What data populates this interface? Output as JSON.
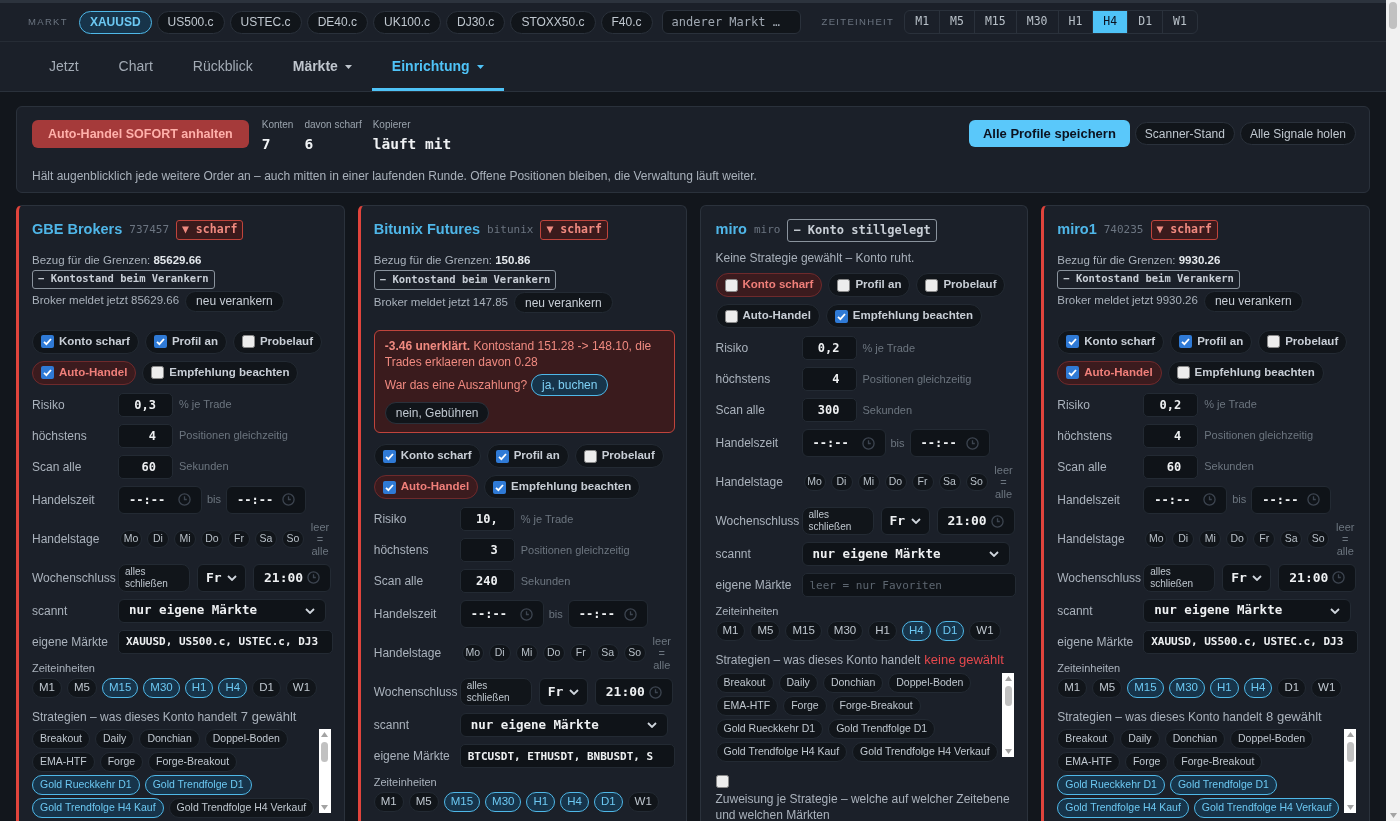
{
  "market_bar": {
    "label": "MARKT",
    "markets": [
      {
        "label": "XAUUSD",
        "selected": true
      },
      {
        "label": "US500.c",
        "selected": false
      },
      {
        "label": "USTEC.c",
        "selected": false
      },
      {
        "label": "DE40.c",
        "selected": false
      },
      {
        "label": "UK100.c",
        "selected": false
      },
      {
        "label": "DJ30.c",
        "selected": false
      },
      {
        "label": "STOXX50.c",
        "selected": false
      },
      {
        "label": "F40.c",
        "selected": false
      }
    ],
    "search": {
      "placeholder": "anderer Markt …"
    },
    "timeframe_label": "ZEITEINHEIT",
    "timeframes": [
      {
        "label": "M1",
        "selected": false
      },
      {
        "label": "M5",
        "selected": false
      },
      {
        "label": "M15",
        "selected": false
      },
      {
        "label": "M30",
        "selected": false
      },
      {
        "label": "H1",
        "selected": false
      },
      {
        "label": "H4",
        "selected": true
      },
      {
        "label": "D1",
        "selected": false
      },
      {
        "label": "W1",
        "selected": false
      }
    ]
  },
  "nav": {
    "tabs": [
      {
        "label": "Jetzt",
        "selected": false,
        "dropdown": false
      },
      {
        "label": "Chart",
        "selected": false,
        "dropdown": false
      },
      {
        "label": "Rückblick",
        "selected": false,
        "dropdown": false
      },
      {
        "label": "Märkte",
        "selected": false,
        "dropdown": true
      },
      {
        "label": "Einrichtung",
        "selected": true,
        "dropdown": true
      }
    ]
  },
  "control_panel": {
    "stop_button": "Auto-Handel SOFORT anhalten",
    "stats": [
      {
        "label": "Konten",
        "value": "7"
      },
      {
        "label": "davon scharf",
        "value": "6"
      },
      {
        "label": "Kopierer",
        "value": "läuft mit"
      }
    ],
    "actions": [
      {
        "label": "Alle Profile speichern",
        "kind": "primary"
      },
      {
        "label": "Scanner-Stand",
        "kind": "secondary"
      },
      {
        "label": "Alle Signale holen",
        "kind": "secondary"
      }
    ],
    "note": "Hält augenblicklich jede weitere Order an – auch mitten in einer laufenden Runde. Offene Positionen bleiben, die Verwaltung läuft weiter."
  },
  "accounts": [
    {
      "name": "GBE Brokers",
      "id": "737457",
      "armed": true,
      "badge": "▼ scharf",
      "reference": "Bezug für die Grenzen: **85629.66**",
      "anchor_tag": "− Kontostand beim Verankern",
      "broker_balance": "Broker meldet jetzt 85629.66",
      "reanchor_button": "neu verankern",
      "toggles": [
        {
          "label": "Konto scharf",
          "checked": true,
          "warn": false
        },
        {
          "label": "Profil an",
          "checked": true,
          "warn": false
        },
        {
          "label": "Probelauf",
          "checked": false,
          "warn": false
        },
        {
          "label": "Auto-Handel",
          "checked": true,
          "warn": true
        },
        {
          "label": "Empfehlung beachten",
          "checked": false,
          "warn": false
        }
      ],
      "fields": [
        {
          "label": "Risiko",
          "value": "0,3",
          "unit": "% je Trade"
        },
        {
          "label": "höchstens",
          "value": "4",
          "unit": "Positionen gleichzeitig"
        },
        {
          "label": "Scan alle",
          "value": "60",
          "unit": "Sekunden"
        }
      ],
      "trading_hours": {
        "label": "Handelszeit",
        "from": "--:--",
        "separator": "bis",
        "to": "--:--"
      },
      "trading_days": {
        "label": "Handelstage",
        "days": [
          {
            "label": "Mo",
            "selected": false
          },
          {
            "label": "Di",
            "selected": false
          },
          {
            "label": "Mi",
            "selected": false
          },
          {
            "label": "Do",
            "selected": false
          },
          {
            "label": "Fr",
            "selected": false
          },
          {
            "label": "Sa",
            "selected": false
          },
          {
            "label": "So",
            "selected": false
          }
        ],
        "hint": "leer = alle"
      },
      "weekend_close": {
        "label": "Wochenschluss",
        "action_button": "alles schließen",
        "day": "Fr",
        "time": "21:00"
      },
      "scan_mode": {
        "label": "scannt",
        "value": "nur eigene Märkte"
      },
      "own_markets": {
        "label": "eigene Märkte",
        "value": "XAUUSD, US500.c, USTEC.c, DJ3"
      },
      "timeframes": {
        "label": "Zeiteinheiten",
        "items": [
          {
            "label": "M1",
            "selected": false
          },
          {
            "label": "M5",
            "selected": false
          },
          {
            "label": "M15",
            "selected": true
          },
          {
            "label": "M30",
            "selected": true
          },
          {
            "label": "H1",
            "selected": true
          },
          {
            "label": "H4",
            "selected": true
          },
          {
            "label": "D1",
            "selected": false
          },
          {
            "label": "W1",
            "selected": false
          }
        ]
      },
      "strategies": {
        "label": "Strategien – was dieses Konto handelt",
        "count": "7 gewählt",
        "warn": false,
        "items": [
          {
            "label": "Breakout",
            "selected": false
          },
          {
            "label": "Daily",
            "selected": false
          },
          {
            "label": "Donchian",
            "selected": false
          },
          {
            "label": "Doppel-Boden",
            "selected": false
          },
          {
            "label": "EMA-HTF",
            "selected": false
          },
          {
            "label": "Forge",
            "selected": false
          },
          {
            "label": "Forge-Breakout",
            "selected": false
          },
          {
            "label": "Gold Rueckkehr D1",
            "selected": true
          },
          {
            "label": "Gold Trendfolge D1",
            "selected": true
          },
          {
            "label": "Gold Trendfolge H4 Kauf",
            "selected": true
          },
          {
            "label": "Gold Trendfolge H4 Verkauf",
            "selected": false
          }
        ]
      }
    },
    {
      "name": "Bitunix Futures",
      "id": "bitunix",
      "armed": true,
      "badge": "▼ scharf",
      "reference": "Bezug für die Grenzen: **150.86**",
      "anchor_tag": "− Kontostand beim Verankern",
      "broker_balance": "Broker meldet jetzt 147.85",
      "reanchor_button": "neu verankern",
      "alert": {
        "message": "**-3.46 unerklärt.** Kontostand 151.28 -> 148.10, die Trades erklaeren davon 0.28",
        "question": "War das eine Auszahlung?",
        "buttons": [
          {
            "label": "ja, buchen",
            "kind": "primary"
          },
          {
            "label": "nein, Gebühren",
            "kind": "secondary"
          }
        ]
      },
      "toggles": [
        {
          "label": "Konto scharf",
          "checked": true,
          "warn": false
        },
        {
          "label": "Profil an",
          "checked": true,
          "warn": false
        },
        {
          "label": "Probelauf",
          "checked": false,
          "warn": false
        },
        {
          "label": "Auto-Handel",
          "checked": true,
          "warn": true
        },
        {
          "label": "Empfehlung beachten",
          "checked": true,
          "warn": false
        }
      ],
      "fields": [
        {
          "label": "Risiko",
          "value": "10,",
          "unit": "% je Trade"
        },
        {
          "label": "höchstens",
          "value": "3",
          "unit": "Positionen gleichzeitig"
        },
        {
          "label": "Scan alle",
          "value": "240",
          "unit": "Sekunden"
        }
      ],
      "trading_hours": {
        "label": "Handelszeit",
        "from": "--:--",
        "separator": "bis",
        "to": "--:--"
      },
      "trading_days": {
        "label": "Handelstage",
        "days": [
          {
            "label": "Mo",
            "selected": false
          },
          {
            "label": "Di",
            "selected": false
          },
          {
            "label": "Mi",
            "selected": false
          },
          {
            "label": "Do",
            "selected": false
          },
          {
            "label": "Fr",
            "selected": false
          },
          {
            "label": "Sa",
            "selected": false
          },
          {
            "label": "So",
            "selected": false
          }
        ],
        "hint": "leer = alle"
      },
      "weekend_close": {
        "label": "Wochenschluss",
        "action_button": "alles schließen",
        "day": "Fr",
        "time": "21:00"
      },
      "scan_mode": {
        "label": "scannt",
        "value": "nur eigene Märkte"
      },
      "own_markets": {
        "label": "eigene Märkte",
        "value": "BTCUSDT, ETHUSDT, BNBUSDT, S"
      },
      "timeframes": {
        "label": "Zeiteinheiten",
        "items": [
          {
            "label": "M1",
            "selected": false
          },
          {
            "label": "M5",
            "selected": false
          },
          {
            "label": "M15",
            "selected": true
          },
          {
            "label": "M30",
            "selected": true
          },
          {
            "label": "H1",
            "selected": true
          },
          {
            "label": "H4",
            "selected": true
          },
          {
            "label": "D1",
            "selected": true
          },
          {
            "label": "W1",
            "selected": false
          }
        ]
      }
    },
    {
      "name": "miro",
      "id": "miro",
      "armed": false,
      "badge": "− Konto stillgelegt",
      "status_note": "Keine Strategie gewählt – Konto ruht.",
      "toggles": [
        {
          "label": "Konto scharf",
          "checked": false,
          "warn": true
        },
        {
          "label": "Profil an",
          "checked": false,
          "warn": false
        },
        {
          "label": "Probelauf",
          "checked": false,
          "warn": false
        },
        {
          "label": "Auto-Handel",
          "checked": false,
          "warn": false
        },
        {
          "label": "Empfehlung beachten",
          "checked": true,
          "warn": false
        }
      ],
      "fields": [
        {
          "label": "Risiko",
          "value": "0,2",
          "unit": "% je Trade"
        },
        {
          "label": "höchstens",
          "value": "4",
          "unit": "Positionen gleichzeitig"
        },
        {
          "label": "Scan alle",
          "value": "300",
          "unit": "Sekunden"
        }
      ],
      "trading_hours": {
        "label": "Handelszeit",
        "from": "--:--",
        "separator": "bis",
        "to": "--:--"
      },
      "trading_days": {
        "label": "Handelstage",
        "days": [
          {
            "label": "Mo",
            "selected": false
          },
          {
            "label": "Di",
            "selected": false
          },
          {
            "label": "Mi",
            "selected": false
          },
          {
            "label": "Do",
            "selected": false
          },
          {
            "label": "Fr",
            "selected": false
          },
          {
            "label": "Sa",
            "selected": false
          },
          {
            "label": "So",
            "selected": false
          }
        ],
        "hint": "leer = alle"
      },
      "weekend_close": {
        "label": "Wochenschluss",
        "action_button": "alles schließen",
        "day": "Fr",
        "time": "21:00"
      },
      "scan_mode": {
        "label": "scannt",
        "value": "nur eigene Märkte"
      },
      "own_markets": {
        "label": "eigene Märkte",
        "placeholder": "leer = nur Favoriten"
      },
      "timeframes": {
        "label": "Zeiteinheiten",
        "items": [
          {
            "label": "M1",
            "selected": false
          },
          {
            "label": "M5",
            "selected": false
          },
          {
            "label": "M15",
            "selected": false
          },
          {
            "label": "M30",
            "selected": false
          },
          {
            "label": "H1",
            "selected": false
          },
          {
            "label": "H4",
            "selected": true
          },
          {
            "label": "D1",
            "selected": true
          },
          {
            "label": "W1",
            "selected": false
          }
        ]
      },
      "strategies": {
        "label": "Strategien – was dieses Konto handelt",
        "count": "keine gewählt",
        "warn": true,
        "items": [
          {
            "label": "Breakout",
            "selected": false
          },
          {
            "label": "Daily",
            "selected": false
          },
          {
            "label": "Donchian",
            "selected": false
          },
          {
            "label": "Doppel-Boden",
            "selected": false
          },
          {
            "label": "EMA-HTF",
            "selected": false
          },
          {
            "label": "Forge",
            "selected": false
          },
          {
            "label": "Forge-Breakout",
            "selected": false
          },
          {
            "label": "Gold Rueckkehr D1",
            "selected": false
          },
          {
            "label": "Gold Trendfolge D1",
            "selected": false
          },
          {
            "label": "Gold Trendfolge H4 Kauf",
            "selected": false
          },
          {
            "label": "Gold Trendfolge H4 Verkauf",
            "selected": false
          }
        ]
      },
      "assignment": {
        "checked": false,
        "label": "Zuweisung je Strategie – welche auf welcher Zeitebene und welchen Märkten"
      }
    },
    {
      "name": "miro1",
      "id": "740235",
      "armed": true,
      "badge": "▼ scharf",
      "reference": "Bezug für die Grenzen: **9930.26**",
      "anchor_tag": "− Kontostand beim Verankern",
      "broker_balance": "Broker meldet jetzt 9930.26",
      "reanchor_button": "neu verankern",
      "toggles": [
        {
          "label": "Konto scharf",
          "checked": true,
          "warn": false
        },
        {
          "label": "Profil an",
          "checked": true,
          "warn": false
        },
        {
          "label": "Probelauf",
          "checked": false,
          "warn": false
        },
        {
          "label": "Auto-Handel",
          "checked": true,
          "warn": true
        },
        {
          "label": "Empfehlung beachten",
          "checked": false,
          "warn": false
        }
      ],
      "fields": [
        {
          "label": "Risiko",
          "value": "0,2",
          "unit": "% je Trade"
        },
        {
          "label": "höchstens",
          "value": "4",
          "unit": "Positionen gleichzeitig"
        },
        {
          "label": "Scan alle",
          "value": "60",
          "unit": "Sekunden"
        }
      ],
      "trading_hours": {
        "label": "Handelszeit",
        "from": "--:--",
        "separator": "bis",
        "to": "--:--"
      },
      "trading_days": {
        "label": "Handelstage",
        "days": [
          {
            "label": "Mo",
            "selected": false
          },
          {
            "label": "Di",
            "selected": false
          },
          {
            "label": "Mi",
            "selected": false
          },
          {
            "label": "Do",
            "selected": false
          },
          {
            "label": "Fr",
            "selected": false
          },
          {
            "label": "Sa",
            "selected": false
          },
          {
            "label": "So",
            "selected": false
          }
        ],
        "hint": "leer = alle"
      },
      "weekend_close": {
        "label": "Wochenschluss",
        "action_button": "alles schließen",
        "day": "Fr",
        "time": "21:00"
      },
      "scan_mode": {
        "label": "scannt",
        "value": "nur eigene Märkte"
      },
      "own_markets": {
        "label": "eigene Märkte",
        "value": "XAUUSD, US500.c, USTEC.c, DJ3"
      },
      "timeframes": {
        "label": "Zeiteinheiten",
        "items": [
          {
            "label": "M1",
            "selected": false
          },
          {
            "label": "M5",
            "selected": false
          },
          {
            "label": "M15",
            "selected": true
          },
          {
            "label": "M30",
            "selected": true
          },
          {
            "label": "H1",
            "selected": true
          },
          {
            "label": "H4",
            "selected": true
          },
          {
            "label": "D1",
            "selected": false
          },
          {
            "label": "W1",
            "selected": false
          }
        ]
      },
      "strategies": {
        "label": "Strategien – was dieses Konto handelt",
        "count": "8 gewählt",
        "warn": false,
        "items": [
          {
            "label": "Breakout",
            "selected": false
          },
          {
            "label": "Daily",
            "selected": false
          },
          {
            "label": "Donchian",
            "selected": false
          },
          {
            "label": "Doppel-Boden",
            "selected": false
          },
          {
            "label": "EMA-HTF",
            "selected": false
          },
          {
            "label": "Forge",
            "selected": false
          },
          {
            "label": "Forge-Breakout",
            "selected": false
          },
          {
            "label": "Gold Rueckkehr D1",
            "selected": true
          },
          {
            "label": "Gold Trendfolge D1",
            "selected": true
          },
          {
            "label": "Gold Trendfolge H4 Kauf",
            "selected": true
          },
          {
            "label": "Gold Trendfolge H4 Verkauf",
            "selected": true
          }
        ]
      }
    }
  ]
}
